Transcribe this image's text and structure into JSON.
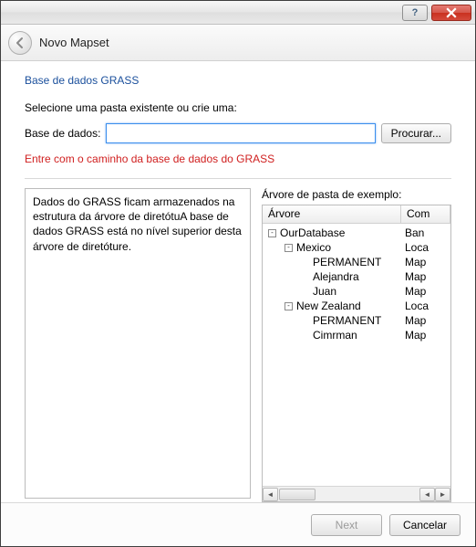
{
  "window": {
    "help_tooltip": "?",
    "close_tooltip": "Close"
  },
  "header": {
    "title": "Novo Mapset"
  },
  "page": {
    "section_title": "Base de dados GRASS",
    "instruction": "Selecione uma pasta existente ou crie uma:",
    "db_label": "Base de dados:",
    "db_value": "",
    "db_placeholder": "",
    "browse_label": "Procurar...",
    "warning": "Entre com o caminho da base de dados do GRASS",
    "description": "Dados do GRASS ficam armazenados na estrutura da árvore de diretótuA base de dados GRASS está no nível superior desta árvore de diretóture."
  },
  "tree": {
    "label": "Árvore de pasta de exemplo:",
    "col1_header": "Árvore",
    "col2_header": "Comentário",
    "col2_header_vis": "Com",
    "rows": [
      {
        "depth": 0,
        "toggle": "-",
        "name": "OurDatabase",
        "c2": "Ban"
      },
      {
        "depth": 1,
        "toggle": "-",
        "name": "Mexico",
        "c2": "Loca"
      },
      {
        "depth": 2,
        "toggle": "",
        "name": "PERMANENT",
        "c2": "Map"
      },
      {
        "depth": 2,
        "toggle": "",
        "name": "Alejandra",
        "c2": "Map"
      },
      {
        "depth": 2,
        "toggle": "",
        "name": "Juan",
        "c2": "Map"
      },
      {
        "depth": 1,
        "toggle": "-",
        "name": "New Zealand",
        "c2": "Loca"
      },
      {
        "depth": 2,
        "toggle": "",
        "name": "PERMANENT",
        "c2": "Map"
      },
      {
        "depth": 2,
        "toggle": "",
        "name": "Cimrman",
        "c2": "Map"
      }
    ]
  },
  "footer": {
    "next_label": "Next",
    "cancel_label": "Cancelar"
  },
  "icons": {
    "back": "back-arrow-icon",
    "help": "help-icon",
    "close": "close-icon",
    "scroll_left": "◄",
    "scroll_right": "►"
  }
}
